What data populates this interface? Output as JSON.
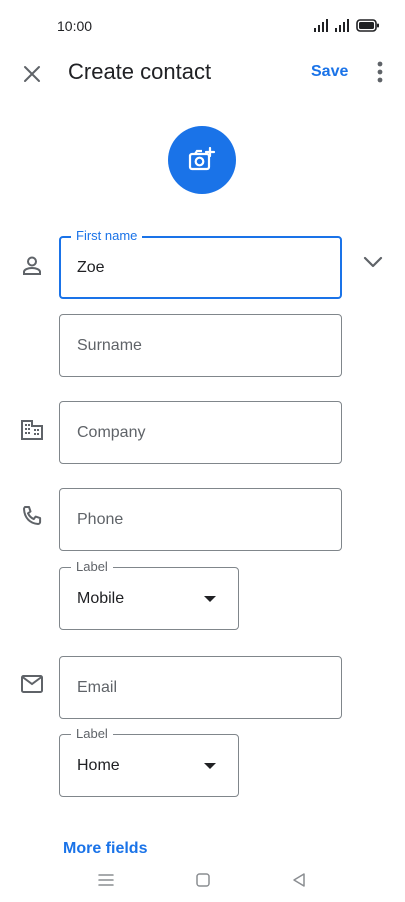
{
  "status_bar": {
    "time": "10:00"
  },
  "app_bar": {
    "title": "Create contact",
    "save_label": "Save"
  },
  "form": {
    "first_name": {
      "label": "First name",
      "value": "Zoe"
    },
    "surname": {
      "placeholder": "Surname"
    },
    "company": {
      "placeholder": "Company"
    },
    "phone": {
      "placeholder": "Phone"
    },
    "phone_label": {
      "label": "Label",
      "value": "Mobile"
    },
    "email": {
      "placeholder": "Email"
    },
    "email_label": {
      "label": "Label",
      "value": "Home"
    }
  },
  "more_fields_label": "More fields",
  "colors": {
    "accent": "#1a73e8",
    "text": "#202124",
    "outline": "#80868b",
    "secondary": "#5f6368"
  },
  "icons": {
    "close": "close-icon",
    "more": "more-vert-icon",
    "add_photo": "add-photo-icon",
    "person": "person-icon",
    "expand": "chevron-down-icon",
    "company": "business-icon",
    "phone": "phone-icon",
    "email": "email-icon"
  }
}
